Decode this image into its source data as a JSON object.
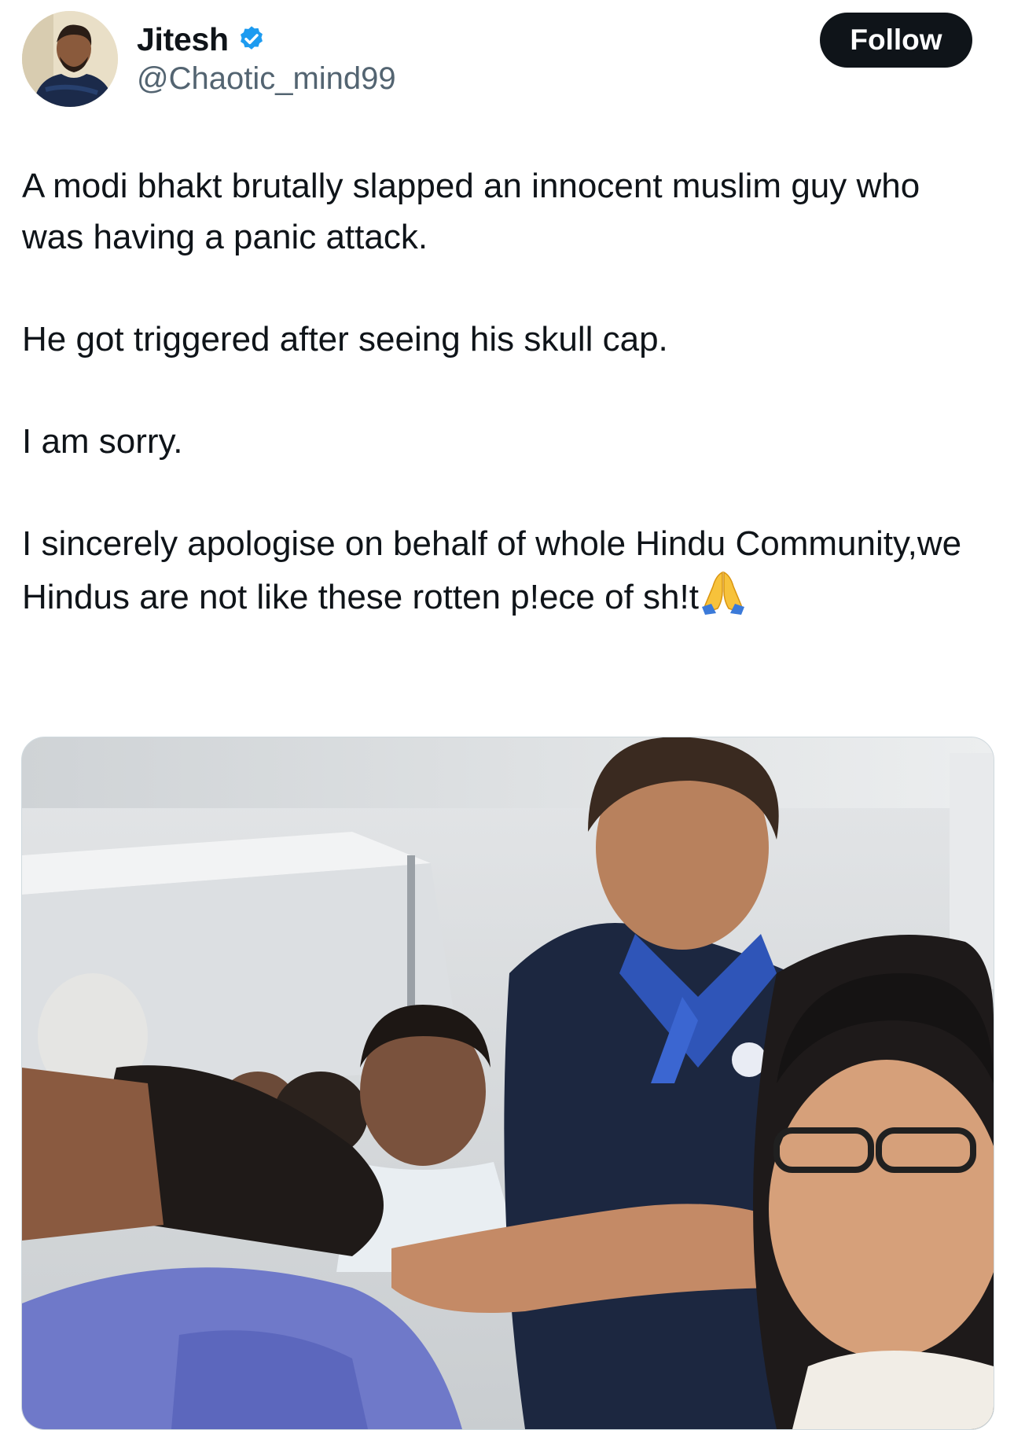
{
  "author": {
    "display_name": "Jitesh",
    "handle": "@Chaotic_mind99",
    "verified": true,
    "verified_badge_color": "#1d9bf0"
  },
  "follow_button": {
    "label": "Follow",
    "background": "#0f1419",
    "text_color": "#ffffff"
  },
  "tweet": {
    "paragraphs": [
      "A modi bhakt brutally slapped an innocent muslim guy who was having a panic attack.",
      "He got triggered after seeing his skull cap.",
      "I am sorry.",
      "I sincerely apologise on behalf of whole Hindu Community,we Hindus are not like these rotten p!ece of sh!t"
    ],
    "trailing_emoji": "folded-hands-emoji"
  },
  "media": {
    "type": "video-still",
    "icons": [
      "folded-hands-emoji",
      "verified-badge-icon"
    ]
  }
}
